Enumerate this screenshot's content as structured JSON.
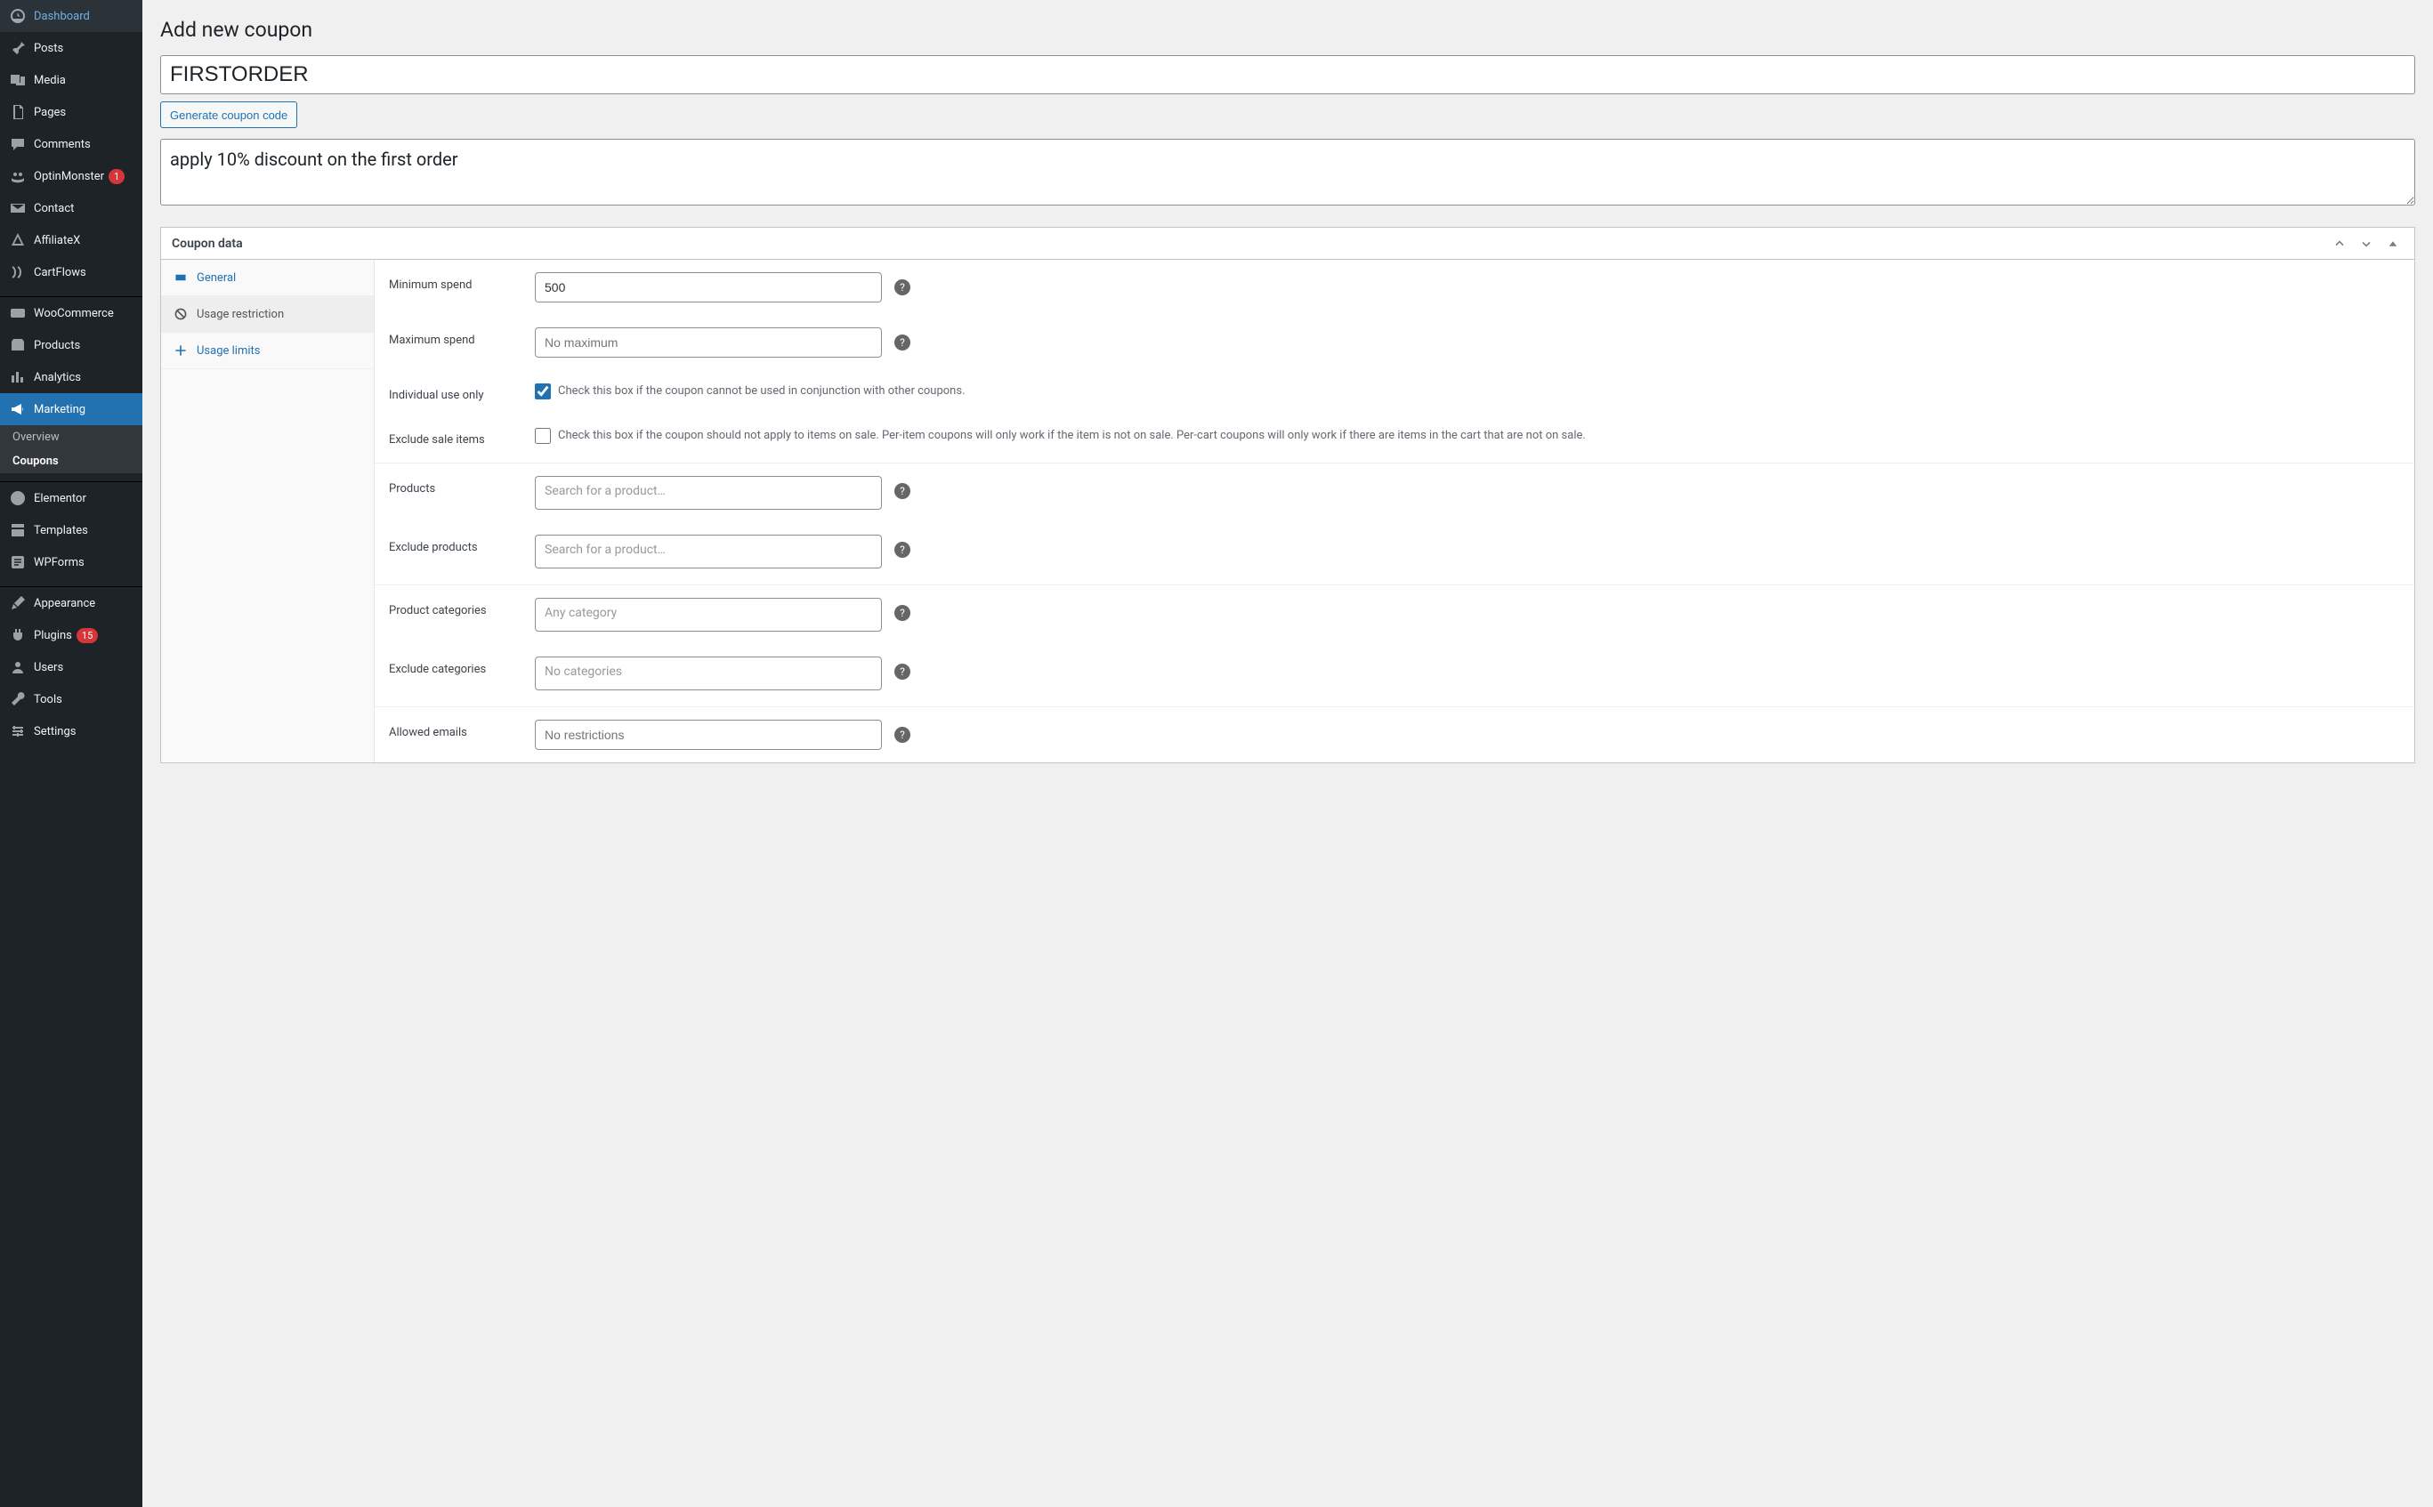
{
  "page": {
    "title": "Add new coupon"
  },
  "sidebar": {
    "items": [
      {
        "label": "Dashboard"
      },
      {
        "label": "Posts"
      },
      {
        "label": "Media"
      },
      {
        "label": "Pages"
      },
      {
        "label": "Comments"
      },
      {
        "label": "OptinMonster",
        "badge": "1"
      },
      {
        "label": "Contact"
      },
      {
        "label": "AffiliateX"
      },
      {
        "label": "CartFlows"
      },
      {
        "label": "WooCommerce"
      },
      {
        "label": "Products"
      },
      {
        "label": "Analytics"
      },
      {
        "label": "Marketing"
      },
      {
        "label": "Elementor"
      },
      {
        "label": "Templates"
      },
      {
        "label": "WPForms"
      },
      {
        "label": "Appearance"
      },
      {
        "label": "Plugins",
        "badge": "15"
      },
      {
        "label": "Users"
      },
      {
        "label": "Tools"
      },
      {
        "label": "Settings"
      }
    ],
    "submenuMarketing": [
      {
        "label": "Overview"
      },
      {
        "label": "Coupons"
      }
    ]
  },
  "coupon": {
    "code": "FIRSTORDER",
    "generate_btn": "Generate coupon code",
    "description": "apply 10% discount on the first order"
  },
  "metabox": {
    "title": "Coupon data",
    "tabs": {
      "general": "General",
      "usage_restriction": "Usage restriction",
      "usage_limits": "Usage limits"
    }
  },
  "fields": {
    "min_spend": {
      "label": "Minimum spend",
      "value": "500"
    },
    "max_spend": {
      "label": "Maximum spend",
      "placeholder": "No maximum"
    },
    "individual_use": {
      "label": "Individual use only",
      "desc": "Check this box if the coupon cannot be used in conjunction with other coupons.",
      "checked": true
    },
    "exclude_sale": {
      "label": "Exclude sale items",
      "desc": "Check this box if the coupon should not apply to items on sale. Per-item coupons will only work if the item is not on sale. Per-cart coupons will only work if there are items in the cart that are not on sale.",
      "checked": false
    },
    "products": {
      "label": "Products",
      "placeholder": "Search for a product…"
    },
    "exclude_products": {
      "label": "Exclude products",
      "placeholder": "Search for a product…"
    },
    "categories": {
      "label": "Product categories",
      "placeholder": "Any category"
    },
    "exclude_categories": {
      "label": "Exclude categories",
      "placeholder": "No categories"
    },
    "allowed_emails": {
      "label": "Allowed emails",
      "placeholder": "No restrictions"
    }
  }
}
